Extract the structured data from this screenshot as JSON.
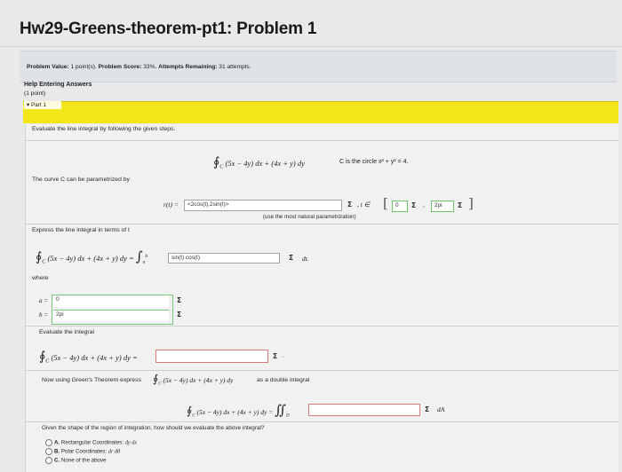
{
  "title": "Hw29-Greens-theorem-pt1: Problem 1",
  "info": {
    "value_label": "Problem Value:",
    "value": "1 point(s).",
    "score_label": "Problem Score:",
    "score": "33%.",
    "attempts_label": "Attempts Remaining:",
    "attempts": "31 attempts."
  },
  "help_link": "Help Entering Answers",
  "points": "(1 point)",
  "part_label": "▾ Part 1",
  "instructions": "Evaluate the line integral by following the given steps.",
  "integral_display": "(5x − 4y) dx + (4x + y) dy",
  "curve_desc": "C is the circle x² + y² = 4.",
  "param_prompt": "The curve C can be parametrized by",
  "r_label": "r(t) =",
  "r_value": "<2cos(t),2sin(t)>",
  "t_in": ", t ∈",
  "interval_start": "0",
  "interval_end": "2pi",
  "comma": ",",
  "param_note": "(use the most natural parametrization)",
  "express_prompt": "Express the line integral in terms of t",
  "integral_eq": "(5x − 4y) dx + (4x + y) dy =",
  "integrand_value": "sin(t) cos(t)",
  "dt": "dt.",
  "where": "where",
  "a_label": "a =",
  "a_value": "0",
  "b_label": "b =",
  "b_value": "2pi",
  "evaluate_label": "Evaluate the integral",
  "eval_eq": "(5x − 4y) dx + (4x + y) dy =",
  "eval_value": "",
  "period": ".",
  "greens_prompt": "Now using Green's Theorem express",
  "greens_tail": "as a double integral",
  "double_eq": "(5x − 4y) dx + (4x + y) dy =",
  "double_value": "",
  "dA": "dA",
  "shape_question": "Given the shape of the region of integration, how should we evaluate the above integral?",
  "options": [
    {
      "letter": "A.",
      "text": "Rectangular Coordinates:",
      "math": "dy dx"
    },
    {
      "letter": "B.",
      "text": "Polar Coordinates:",
      "math": "dr dθ"
    },
    {
      "letter": "C.",
      "text": "None of the above",
      "math": ""
    }
  ],
  "sigma": "Σ",
  "oint_symbol": "∮",
  "int_symbol": "∫",
  "dbl_int_symbol": "∬",
  "sub_c": "C",
  "sub_d": "D",
  "sub_a": "a",
  "sup_b": "b",
  "colors": {
    "part_bar": "#f3e61a",
    "info_bar": "#dfe3e8",
    "correct_border": "#6fc26b"
  }
}
